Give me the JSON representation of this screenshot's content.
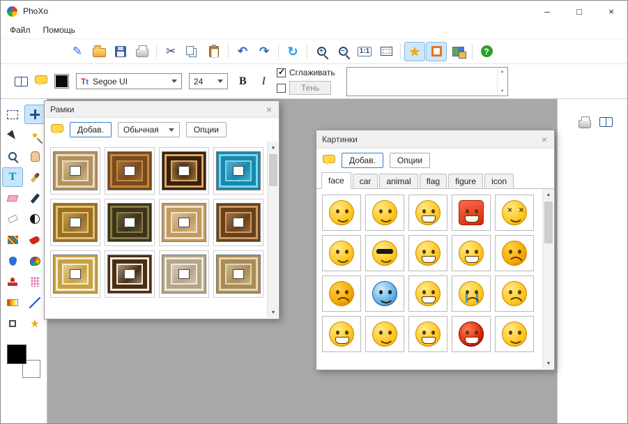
{
  "colors": {
    "accent": "#2f7fd0",
    "canvas": "#a8a8a8",
    "toolbar_highlight": "#cfe6f8"
  },
  "titlebar": {
    "title": "PhoXo",
    "minimize": "–",
    "maximize": "□",
    "close": "×"
  },
  "menubar": {
    "items": [
      {
        "name": "menu-file",
        "label": "Файл"
      },
      {
        "name": "menu-help",
        "label": "Помощь"
      }
    ]
  },
  "toolbar": {
    "items": [
      {
        "name": "new-button",
        "cls": "i-new",
        "glyph": "✎"
      },
      {
        "name": "open-button",
        "cls": "i-folder"
      },
      {
        "name": "save-button",
        "cls": "i-save"
      },
      {
        "name": "print-button",
        "cls": "i-print"
      },
      {
        "name": "separator",
        "type": "sep",
        "inter": "false"
      },
      {
        "name": "cut-button",
        "cls": "i-cut",
        "glyph": "✂"
      },
      {
        "name": "copy-button",
        "cls": "i-copy"
      },
      {
        "name": "paste-button",
        "cls": "i-paste"
      },
      {
        "name": "separator",
        "type": "sep",
        "inter": "false"
      },
      {
        "name": "undo-button",
        "cls": "i-undo",
        "glyph": "↶"
      },
      {
        "name": "redo-button",
        "cls": "i-redo",
        "glyph": "↷"
      },
      {
        "name": "separator",
        "type": "sep",
        "inter": "false"
      },
      {
        "name": "rotate-button",
        "cls": "i-refresh",
        "glyph": "↻"
      },
      {
        "name": "separator",
        "type": "sep",
        "inter": "false"
      },
      {
        "name": "zoom-in-button",
        "cls": "i-mag",
        "glyph": "+"
      },
      {
        "name": "zoom-out-button",
        "cls": "i-mag",
        "glyph": "−"
      },
      {
        "name": "actual-size-button",
        "cls": "i-actual",
        "glyph": "1:1"
      },
      {
        "name": "fit-window-button",
        "cls": "i-fit"
      },
      {
        "name": "separator",
        "type": "sep",
        "inter": "false"
      },
      {
        "name": "favorites-button",
        "cls": "i-star",
        "glyph": "★",
        "state": "active"
      },
      {
        "name": "frames-button",
        "cls": "i-frames",
        "state": "active"
      },
      {
        "name": "stickers-button",
        "cls": "i-stickers"
      },
      {
        "name": "separator",
        "type": "sep",
        "inter": "false"
      },
      {
        "name": "help-button",
        "cls": "i-help",
        "glyph": "?"
      }
    ]
  },
  "textbar": {
    "font_value": "Segoe UI",
    "size_value": "24",
    "bold_label": "B",
    "italic_label": "I",
    "smooth_label": "Сглаживать",
    "smooth_checked": true,
    "shadow_label": "Тень",
    "shadow_checked": false,
    "text_color": "#000000",
    "text_value": ""
  },
  "tools": {
    "items": [
      {
        "name": "rect-select-tool",
        "cls": "t-rectsel"
      },
      {
        "name": "move-tool",
        "cls": "t-move",
        "state": "active"
      },
      {
        "name": "pick-arrow-tool",
        "cls": "t-arrow"
      },
      {
        "name": "magic-wand-tool",
        "cls": "t-wand",
        "glyph": "★"
      },
      {
        "name": "zoom-tool",
        "cls": "mag"
      },
      {
        "name": "hand-tool",
        "cls": "t-hand"
      },
      {
        "name": "text-tool",
        "cls": "t-text",
        "glyph": "T",
        "state": "active"
      },
      {
        "name": "brush-tool",
        "cls": "t-brush"
      },
      {
        "name": "eraser-tool",
        "cls": "t-eraser"
      },
      {
        "name": "pen-tool",
        "cls": "t-pen"
      },
      {
        "name": "chalk-tool",
        "cls": "t-chalk"
      },
      {
        "name": "contrast-tool",
        "cls": "t-contrast"
      },
      {
        "name": "curve-tool",
        "cls": "t-curve"
      },
      {
        "name": "red-brush-tool",
        "cls": "t-redbrush"
      },
      {
        "name": "fill-tool",
        "cls": "t-fill"
      },
      {
        "name": "palette-tool",
        "cls": "t-palette"
      },
      {
        "name": "stamp-tool",
        "cls": "t-stamp"
      },
      {
        "name": "spray-tool",
        "cls": "t-spray"
      },
      {
        "name": "gradient-tool",
        "cls": "t-gradient"
      },
      {
        "name": "line-tool",
        "cls": "t-line"
      },
      {
        "name": "crop-tool",
        "cls": "t-crop"
      },
      {
        "name": "shape-star-tool",
        "cls": "t-star",
        "glyph": "★"
      }
    ]
  },
  "frames_palette": {
    "title": "Рамки",
    "close": "×",
    "add_label": "Добав.",
    "style_value": "Обычная",
    "options_label": "Опции",
    "items": [
      {
        "name": "frame-cream-ornate",
        "c1": "#e9dcc0",
        "c2": "#b3905e"
      },
      {
        "name": "frame-brown-wood",
        "c1": "#c08a45",
        "c2": "#7a4a1a"
      },
      {
        "name": "frame-dark-vignette",
        "c1": "#d8a868",
        "c2": "#3a2008",
        "grad": "g-radial"
      },
      {
        "name": "frame-teal-ornate",
        "c1": "#7ad4ec",
        "c2": "#1a88ac"
      },
      {
        "name": "frame-golden",
        "c1": "#e3c078",
        "c2": "#9a7020"
      },
      {
        "name": "frame-dark-olive",
        "c1": "#8a7a4a",
        "c2": "#3c3418"
      },
      {
        "name": "frame-beige-pattern",
        "c1": "#efe0c8",
        "c2": "#c09a60"
      },
      {
        "name": "frame-brown-weave",
        "c1": "#c89a68",
        "c2": "#6a4018"
      },
      {
        "name": "frame-gold-white",
        "c1": "#f5eed8",
        "c2": "#c8a040"
      },
      {
        "name": "frame-dark-brown-mat",
        "c1": "#f0ece0",
        "c2": "#4a2e14"
      },
      {
        "name": "frame-light-marble",
        "c1": "#efe8da",
        "c2": "#b5a488"
      },
      {
        "name": "frame-beige-swirl",
        "c1": "#e6d6b2",
        "c2": "#a88c58"
      }
    ]
  },
  "stickers_palette": {
    "title": "Картинки",
    "close": "×",
    "add_label": "Добав.",
    "options_label": "Опции",
    "tabs": [
      {
        "name": "tab-face",
        "label": "face",
        "state": "active"
      },
      {
        "name": "tab-car",
        "label": "car"
      },
      {
        "name": "tab-animal",
        "label": "animal"
      },
      {
        "name": "tab-flag",
        "label": "flag"
      },
      {
        "name": "tab-figure",
        "label": "figure"
      },
      {
        "name": "tab-icon",
        "label": "icon"
      }
    ],
    "items": [
      {
        "name": "sticker-starry-eyes",
        "variant": "f-smile"
      },
      {
        "name": "sticker-happy",
        "variant": "f-smile"
      },
      {
        "name": "sticker-wink-tongue",
        "variant": "f-grin"
      },
      {
        "name": "sticker-red-book",
        "variant": "f-book"
      },
      {
        "name": "sticker-dizzy",
        "variant": "f-dizzy"
      },
      {
        "name": "sticker-heart-eyes",
        "variant": "f-smile"
      },
      {
        "name": "sticker-cool-shades",
        "variant": "f-cool"
      },
      {
        "name": "sticker-money-drool",
        "variant": "f-grin"
      },
      {
        "name": "sticker-big-grin",
        "variant": "f-grin"
      },
      {
        "name": "sticker-furious",
        "variant": "f-angry"
      },
      {
        "name": "sticker-grumpy",
        "variant": "f-angry"
      },
      {
        "name": "sticker-freezing",
        "variant": "f-cold"
      },
      {
        "name": "sticker-shouting",
        "variant": "f-grin"
      },
      {
        "name": "sticker-sobbing",
        "variant": "f-cry"
      },
      {
        "name": "sticker-frowning",
        "variant": "f-sad"
      },
      {
        "name": "sticker-gritting-teeth",
        "variant": "f-grin"
      },
      {
        "name": "sticker-sweat-smile",
        "variant": "f-smile"
      },
      {
        "name": "sticker-laughing",
        "variant": "f-grin"
      },
      {
        "name": "sticker-devil",
        "variant": "f-devil"
      },
      {
        "name": "sticker-slap",
        "variant": "f-smile"
      }
    ]
  },
  "right_panel": {
    "icons": [
      {
        "name": "print-preview-icon",
        "cls": "i-print"
      },
      {
        "name": "book-icon",
        "cls": "i-book"
      }
    ]
  },
  "scrollbar": {
    "up": "▲",
    "down": "▼"
  }
}
